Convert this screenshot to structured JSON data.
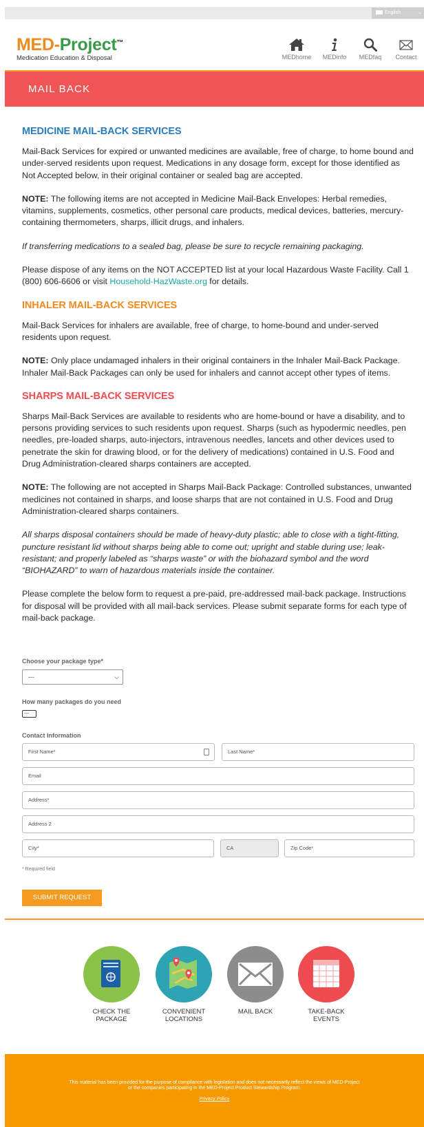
{
  "topbar": {
    "language": "English"
  },
  "logo": {
    "title_med": "MED-",
    "title_project": "Project",
    "trademark": "™",
    "subtitle": "Medication Education & Disposal"
  },
  "nav": [
    {
      "label": "MEDhome",
      "icon": "home-icon"
    },
    {
      "label": "MEDinfo",
      "icon": "info-icon"
    },
    {
      "label": "MEDfaq",
      "icon": "search-icon"
    },
    {
      "label": "Contact",
      "icon": "envelope-icon"
    }
  ],
  "banner": {
    "title": "MAIL BACK"
  },
  "sections": {
    "medicine": {
      "heading": "MEDICINE MAIL-BACK SERVICES",
      "p1": "Mail-Back Services for expired or unwanted medicines are available, free of charge, to home bound and under-served residents upon request. Medications in any dosage form, except for those identified as Not Accepted below, in their original container or sealed bag are accepted.",
      "note_label": "NOTE:",
      "note": " The following items are not accepted in Medicine Mail-Back Envelopes: Herbal remedies, vitamins, supplements, cosmetics, other personal care products, medical devices, batteries, mercury-containing thermometers, sharps, illicit drugs, and inhalers.",
      "italic": "If transferring medications to a sealed bag, please be sure to recycle remaining packaging.",
      "dispose_before": "Please dispose of any items on the NOT ACCEPTED list at your local Hazardous Waste Facility. Call 1 (800) 606-6606 or visit ",
      "dispose_link": "Household-HazWaste.org",
      "dispose_after": " for details."
    },
    "inhaler": {
      "heading": "INHALER MAIL-BACK SERVICES",
      "p1": "Mail-Back Services for inhalers are available, free of charge, to home-bound and under-served residents upon request.",
      "note_label": "NOTE:",
      "note": " Only place undamaged inhalers in their original containers in the Inhaler Mail-Back Package. Inhaler Mail-Back Packages can only be used for inhalers and cannot accept other types of items."
    },
    "sharps": {
      "heading": "SHARPS MAIL-BACK SERVICES",
      "p1": "Sharps Mail-Back Services are available to residents who are home-bound or have a disability, and to persons providing services to such residents upon request. Sharps (such as hypodermic needles, pen needles, pre-loaded sharps, auto-injectors, intravenous needles, lancets and other devices used to penetrate the skin for drawing blood, or for the delivery of medications) contained in U.S. Food and Drug Administration-cleared sharps containers are accepted.",
      "note_label": "NOTE:",
      "note": " The following are not accepted in Sharps Mail-Back Package: Controlled substances, unwanted medicines not contained in sharps, and loose sharps that are not contained in U.S. Food and Drug Administration-cleared sharps containers.",
      "italic": "All sharps disposal containers should be made of heavy-duty plastic; able to close with a tight-fitting, puncture resistant lid without sharps being able to come out; upright and stable during use; leak-resistant; and properly labeled as “sharps waste” or with the biohazard symbol and the word “BIOHAZARD” to warn of hazardous materials inside the container.",
      "form_intro": "Please complete the below form to request a pre-paid, pre-addressed mail-back package. Instructions for disposal will be provided with all mail-back services. Please submit separate forms for each type of mail-back package."
    }
  },
  "form": {
    "package_type_label": "Choose your package type*",
    "package_type_value": "---",
    "quantity_label": "How many packages do you need",
    "quantity_value": "---",
    "contact_label": "Contact Information",
    "first_name": "First Name*",
    "last_name": "Last Name*",
    "email": "Email",
    "address": "Address*",
    "address2": "Address 2",
    "city": "City*",
    "state": "CA",
    "zip": "Zip Code*",
    "required_note": "* Required field",
    "submit": "SUBMIT REQUEST"
  },
  "features": [
    {
      "label_line1": "CHECK THE",
      "label_line2": "PACKAGE",
      "icon": "package-icon",
      "color": "#8bc34a"
    },
    {
      "label_line1": "CONVENIENT",
      "label_line2": "LOCATIONS",
      "icon": "map-icon",
      "color": "#2ea3b4"
    },
    {
      "label_line1": "MAIL BACK",
      "label_line2": "",
      "icon": "mail-icon",
      "color": "#8c8c8c"
    },
    {
      "label_line1": "TAKE-BACK",
      "label_line2": "EVENTS",
      "icon": "calendar-icon",
      "color": "#ee4c50"
    }
  ],
  "footer": {
    "text": "This material has been provided for the purpose of compliance with legislation and does not necessarily reflect the views of MED-Project or the companies participating in the MED-Project Product Stewardship Program.",
    "privacy": "Privacy Policy"
  },
  "colors": {
    "orange": "#f79a20",
    "banner_red": "#f05454",
    "blue": "#2b7cbf",
    "green": "#3a9a47",
    "teal_link": "#1aa79c"
  }
}
